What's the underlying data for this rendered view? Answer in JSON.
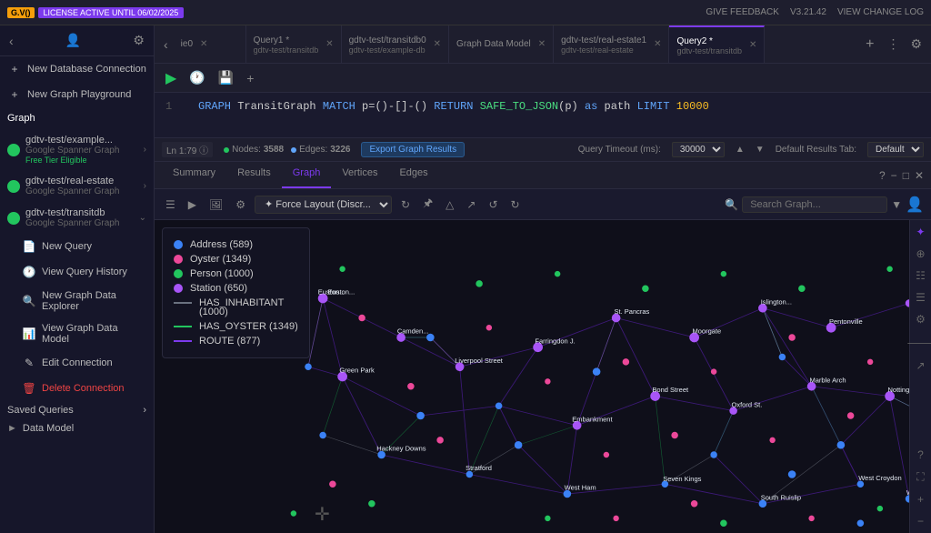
{
  "topbar": {
    "logo": "G.V()",
    "license": "LICENSE ACTIVE UNTIL 06/02/2025",
    "give_feedback": "GIVE FEEDBACK",
    "version": "V3.21.42",
    "view_changelog": "VIEW CHANGE LOG"
  },
  "sidebar": {
    "items": [
      {
        "id": "new-db",
        "label": "New Database Connection",
        "icon": "➕",
        "type": "action"
      },
      {
        "id": "new-playground",
        "label": "New Graph Playground",
        "icon": "➕",
        "type": "action"
      },
      {
        "id": "gdtv-example",
        "label": "gdtv-test/example...",
        "sub": "Google Spanner Graph",
        "free": "Free Tier Eligible",
        "type": "connection",
        "active": true
      },
      {
        "id": "gdtv-real-estate",
        "label": "gdtv-test/real-estate",
        "sub": "Google Spanner Graph",
        "type": "connection",
        "active": true
      },
      {
        "id": "gdtv-transitdb",
        "label": "gdtv-test/transitdb",
        "sub": "Google Spanner Graph",
        "type": "connection",
        "active": true,
        "expanded": true
      },
      {
        "id": "new-query",
        "label": "New Query",
        "icon": "📄",
        "type": "action"
      },
      {
        "id": "view-query-history",
        "label": "View Query History",
        "icon": "🕐",
        "type": "action"
      },
      {
        "id": "new-data-explorer",
        "label": "New Graph Data Explorer",
        "icon": "🔍",
        "type": "action"
      },
      {
        "id": "view-data-model",
        "label": "View Graph Data Model",
        "icon": "📊",
        "type": "action"
      },
      {
        "id": "edit-connection",
        "label": "Edit Connection",
        "icon": "✏️",
        "type": "action"
      },
      {
        "id": "delete-connection",
        "label": "Delete Connection",
        "icon": "🗑️",
        "type": "action",
        "danger": true
      }
    ],
    "saved_queries": "Saved Queries",
    "data_model": "Data Model"
  },
  "tabs": [
    {
      "id": "tab-ie0",
      "label": "ie0",
      "sub": "",
      "active": false
    },
    {
      "id": "tab-query1",
      "label": "Query1 *",
      "sub": "gdtv-test/transitdb",
      "active": false
    },
    {
      "id": "tab-transitdb0",
      "label": "gdtv-test/transitdb0",
      "sub": "gdtv-test/example-db",
      "active": false
    },
    {
      "id": "tab-graph-data-model",
      "label": "Graph Data Model",
      "sub": "",
      "active": false
    },
    {
      "id": "tab-real-estate1",
      "label": "gdtv-test/real-estate1",
      "sub": "gdtv-test/real-estate",
      "active": false
    },
    {
      "id": "tab-query2",
      "label": "Query2 *",
      "sub": "gdtv-test/transitdb",
      "active": true
    }
  ],
  "editor": {
    "line": 1,
    "col": 79,
    "content": "GRAPH TransitGraph MATCH p=()-[]-() RETURN SAFE_TO_JSON(p) as path LIMIT 10000"
  },
  "query_options": {
    "timeout_label": "Query Timeout (ms):",
    "timeout_value": "30000",
    "results_tab_label": "Default Results Tab:",
    "results_tab_value": "Default"
  },
  "stats": {
    "nodes_label": "Nodes:",
    "nodes_value": "3588",
    "edges_label": "Edges:",
    "edges_value": "3226",
    "export_btn": "Export Graph Results"
  },
  "result_tabs": [
    {
      "id": "tab-summary",
      "label": "Summary",
      "active": false
    },
    {
      "id": "tab-results",
      "label": "Results",
      "active": false
    },
    {
      "id": "tab-graph",
      "label": "Graph",
      "active": true
    },
    {
      "id": "tab-vertices",
      "label": "Vertices",
      "active": false
    },
    {
      "id": "tab-edges",
      "label": "Edges",
      "active": false
    }
  ],
  "graph": {
    "layout": "Force Layout (Discr...",
    "search_placeholder": "Search Graph...",
    "legend": [
      {
        "label": "Address (589)",
        "color": "#3b82f6"
      },
      {
        "label": "Oyster (1349)",
        "color": "#ec4899"
      },
      {
        "label": "Person (1000)",
        "color": "#22c55e"
      },
      {
        "label": "Station (650)",
        "color": "#a855f7"
      },
      {
        "label": "HAS_INHABITANT (1000)",
        "color": "#6b7280",
        "type": "line"
      },
      {
        "label": "HAS_OYSTER (1349)",
        "color": "#22c55e",
        "type": "line"
      },
      {
        "label": "ROUTE (877)",
        "color": "#7c3aed",
        "type": "line"
      }
    ]
  },
  "graph_title": "Graph _"
}
